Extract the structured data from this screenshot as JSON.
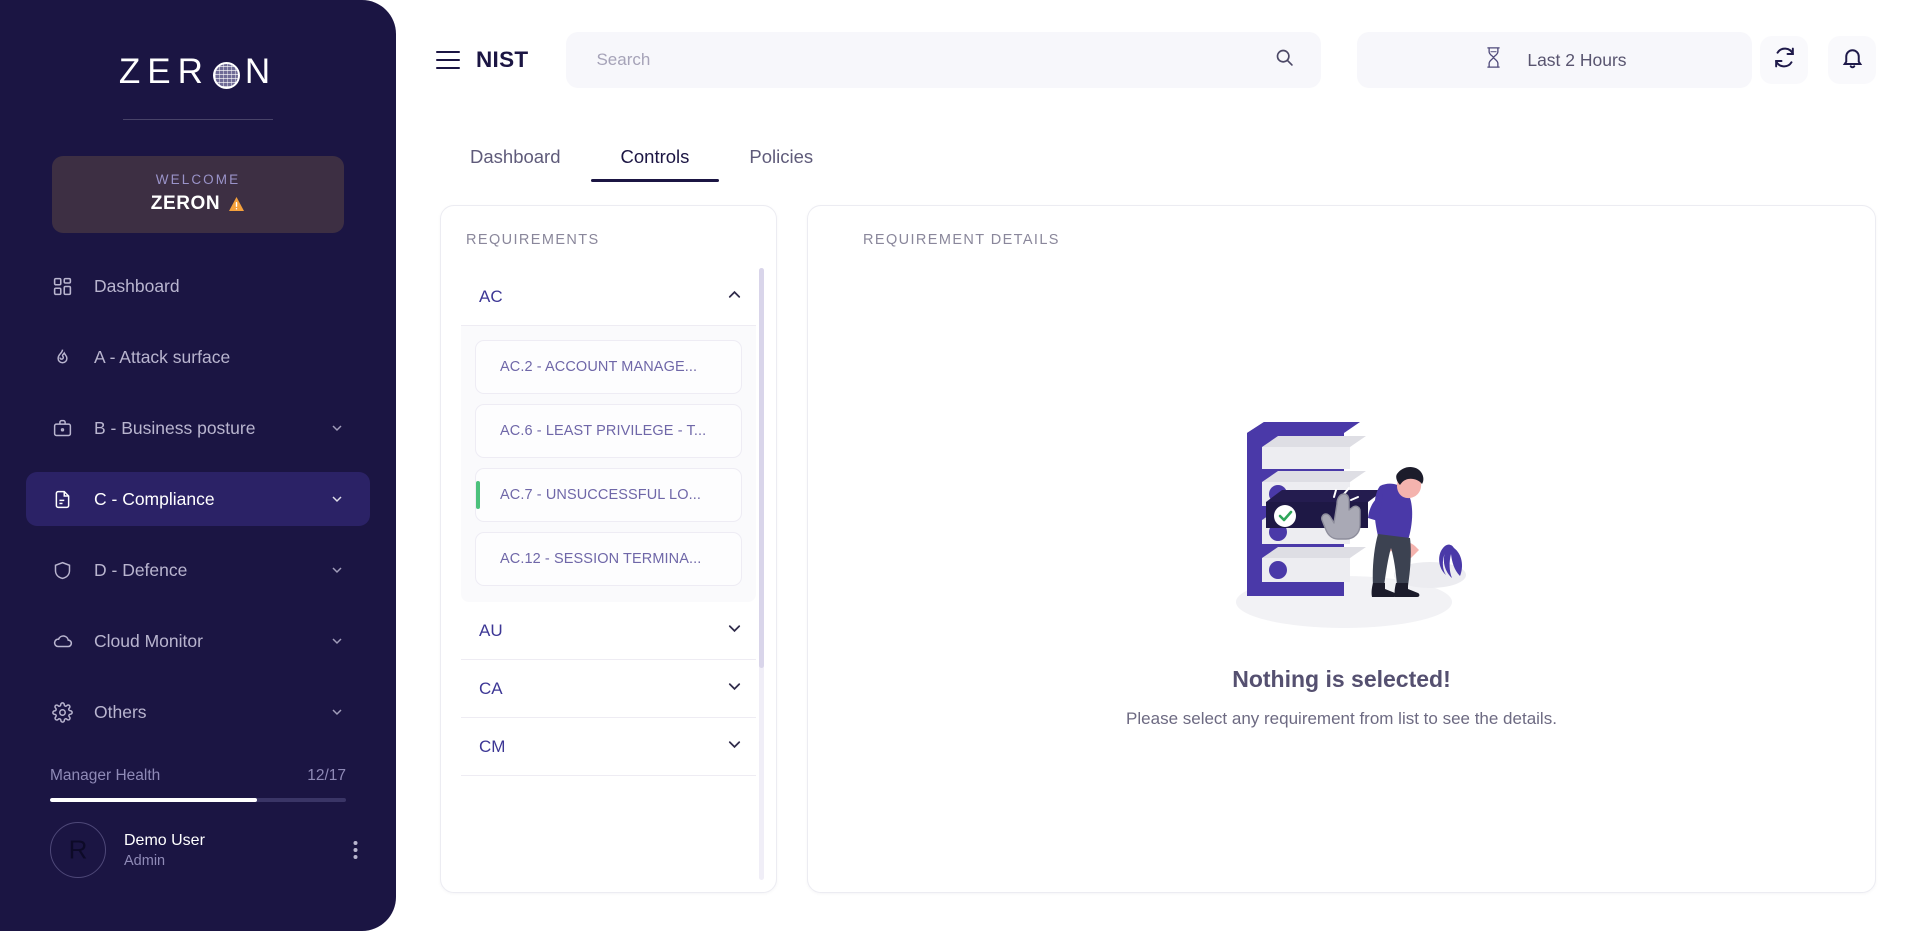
{
  "sidebar": {
    "brand": {
      "text_left": "ZER",
      "text_right": "N",
      "icon": "globe-icon"
    },
    "welcome": {
      "label": "WELCOME",
      "name": "ZERON",
      "badge_icon": "warning-triangle-icon"
    },
    "nav": [
      {
        "label": "Dashboard",
        "icon": "grid-icon",
        "active": false,
        "chevron": false
      },
      {
        "label": "A - Attack surface",
        "icon": "flame-icon",
        "active": false,
        "chevron": false
      },
      {
        "label": "B - Business posture",
        "icon": "briefcase-icon",
        "active": false,
        "chevron": true
      },
      {
        "label": "C - Compliance",
        "icon": "document-icon",
        "active": true,
        "chevron": true
      },
      {
        "label": "D - Defence",
        "icon": "shield-icon",
        "active": false,
        "chevron": true
      },
      {
        "label": "Cloud Monitor",
        "icon": "cloud-icon",
        "active": false,
        "chevron": true
      },
      {
        "label": "Others",
        "icon": "gear-icon",
        "active": false,
        "chevron": true
      }
    ],
    "health": {
      "label": "Manager Health",
      "value": "12/17",
      "percent": 70
    },
    "profile": {
      "initial": "R",
      "name": "Demo User",
      "role": "Admin",
      "menu_icon": "kebab-menu-icon"
    }
  },
  "topbar": {
    "menu_icon": "hamburger-icon",
    "title": "NIST",
    "search": {
      "placeholder": "Search",
      "value": "",
      "icon": "search-icon"
    },
    "time_range": {
      "label": "Last 2 Hours",
      "icon": "hourglass-icon"
    },
    "refresh": {
      "icon": "refresh-icon"
    },
    "notifications": {
      "icon": "bell-icon"
    }
  },
  "tabs": [
    {
      "label": "Dashboard",
      "active": false
    },
    {
      "label": "Controls",
      "active": true
    },
    {
      "label": "Policies",
      "active": false
    }
  ],
  "requirements": {
    "caption": "REQUIREMENTS",
    "groups": [
      {
        "code": "AC",
        "expanded": true,
        "items": [
          {
            "label": "AC.2 - ACCOUNT MANAGE...",
            "flagged": false
          },
          {
            "label": "AC.6 - LEAST PRIVILEGE - T...",
            "flagged": false
          },
          {
            "label": "AC.7 - UNSUCCESSFUL LO...",
            "flagged": true
          },
          {
            "label": "AC.12 - SESSION TERMINA...",
            "flagged": false
          }
        ]
      },
      {
        "code": "AU",
        "expanded": false,
        "items": []
      },
      {
        "code": "CA",
        "expanded": false,
        "items": []
      },
      {
        "code": "CM",
        "expanded": false,
        "items": []
      }
    ]
  },
  "details": {
    "caption": "REQUIREMENT DETAILS",
    "empty": {
      "illustration": "person-selecting-list-illustration",
      "title": "Nothing is selected!",
      "subtitle": "Please select any requirement from list to see the details."
    }
  },
  "colors": {
    "sidebar_bg": "#1b1543",
    "sidebar_active": "#2b2266",
    "welcome_card": "#3d2f43",
    "accent_purple": "#3d3795",
    "req_text": "#6f67a8",
    "flag_green": "#4cc17c",
    "warning_orange": "#f5a13c"
  }
}
